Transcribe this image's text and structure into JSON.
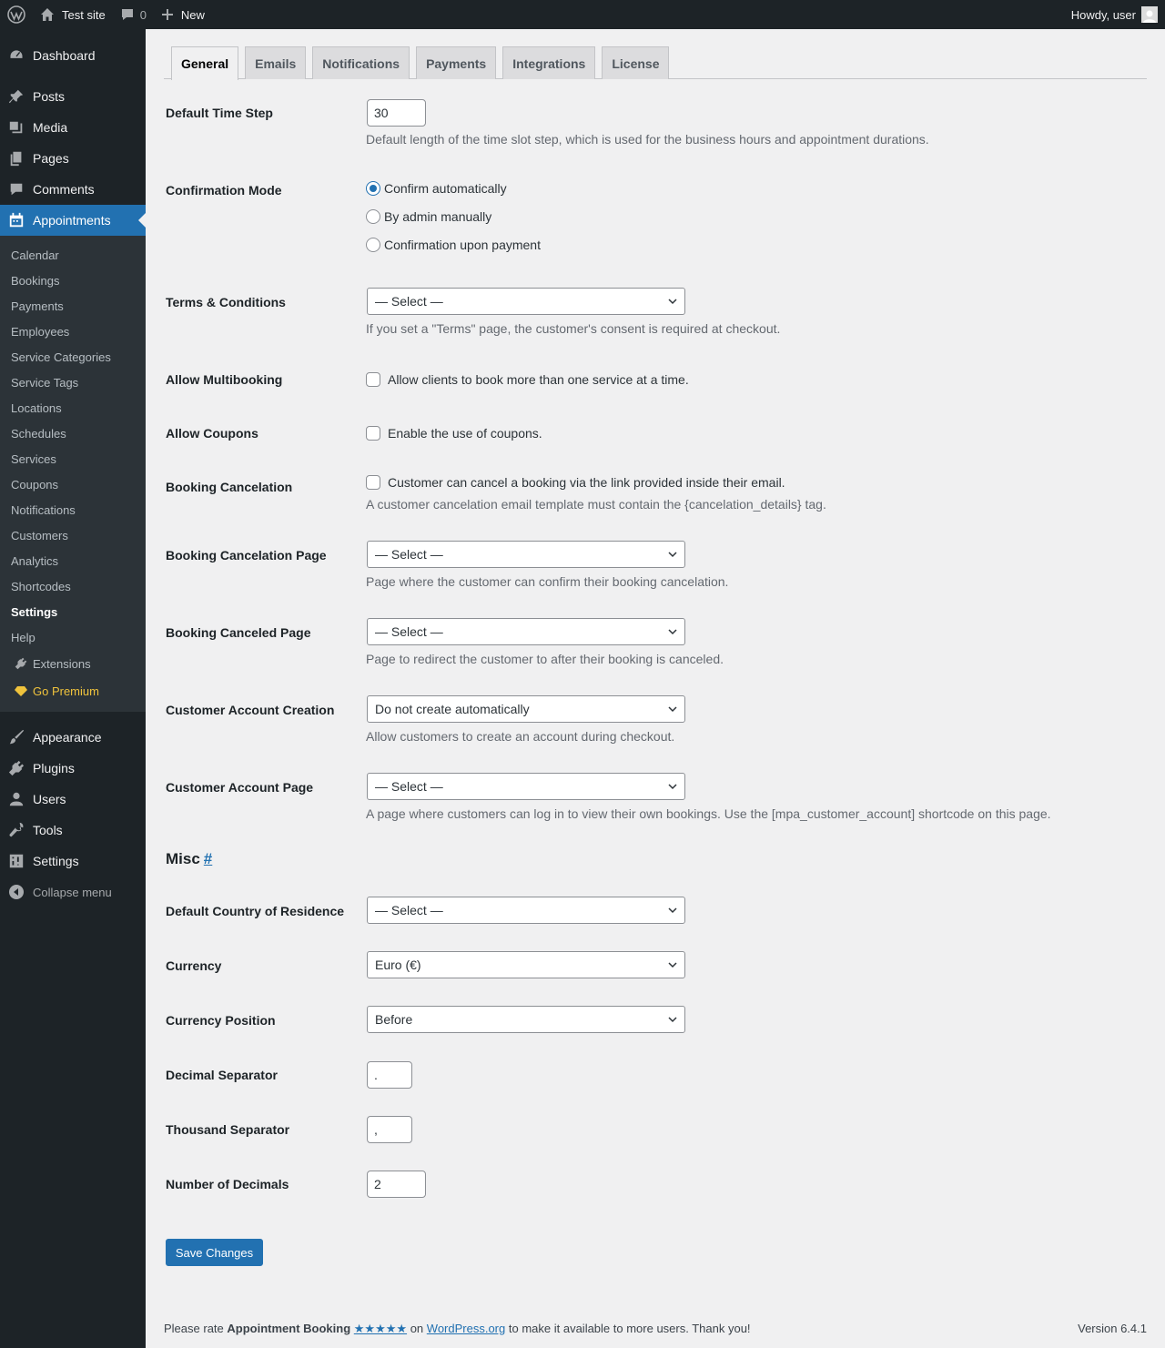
{
  "adminbar": {
    "site_name": "Test site",
    "comments_count": "0",
    "new_label": "New",
    "howdy": "Howdy, user"
  },
  "sidebar": {
    "top_items": [
      {
        "label": "Dashboard",
        "icon": "dashboard-icon"
      },
      {
        "label": "Posts",
        "icon": "pin-icon"
      },
      {
        "label": "Media",
        "icon": "media-icon"
      },
      {
        "label": "Pages",
        "icon": "pages-icon"
      },
      {
        "label": "Comments",
        "icon": "comment-icon"
      },
      {
        "label": "Appointments",
        "icon": "calendar-icon"
      }
    ],
    "submenu": [
      "Calendar",
      "Bookings",
      "Payments",
      "Employees",
      "Service Categories",
      "Service Tags",
      "Locations",
      "Schedules",
      "Services",
      "Coupons",
      "Notifications",
      "Customers",
      "Analytics",
      "Shortcodes",
      "Settings",
      "Help"
    ],
    "extensions": "Extensions",
    "go_premium": "Go Premium",
    "bottom_items": [
      {
        "label": "Appearance",
        "icon": "brush-icon"
      },
      {
        "label": "Plugins",
        "icon": "plugin-icon"
      },
      {
        "label": "Users",
        "icon": "user-icon"
      },
      {
        "label": "Tools",
        "icon": "wrench-icon"
      },
      {
        "label": "Settings",
        "icon": "settings-icon"
      }
    ],
    "collapse": "Collapse menu"
  },
  "tabs": [
    "General",
    "Emails",
    "Notifications",
    "Payments",
    "Integrations",
    "License"
  ],
  "form": {
    "time_step": {
      "label": "Default Time Step",
      "value": "30",
      "desc": "Default length of the time slot step, which is used for the business hours and appointment durations."
    },
    "confirmation": {
      "label": "Confirmation Mode",
      "options": [
        "Confirm automatically",
        "By admin manually",
        "Confirmation upon payment"
      ],
      "selected": "Confirm automatically"
    },
    "terms": {
      "label": "Terms & Conditions",
      "value": "— Select —",
      "desc": "If you set a \"Terms\" page, the customer's consent is required at checkout."
    },
    "multibooking": {
      "label": "Allow Multibooking",
      "text": "Allow clients to book more than one service at a time."
    },
    "coupons": {
      "label": "Allow Coupons",
      "text": "Enable the use of coupons."
    },
    "cancelation": {
      "label": "Booking Cancelation",
      "text": "Customer can cancel a booking via the link provided inside their email.",
      "desc": "A customer cancelation email template must contain the {cancelation_details} tag."
    },
    "cancelation_page": {
      "label": "Booking Cancelation Page",
      "value": "— Select —",
      "desc": "Page where the customer can confirm their booking cancelation."
    },
    "canceled_page": {
      "label": "Booking Canceled Page",
      "value": "— Select —",
      "desc": "Page to redirect the customer to after their booking is canceled."
    },
    "account_creation": {
      "label": "Customer Account Creation",
      "value": "Do not create automatically",
      "desc": "Allow customers to create an account during checkout."
    },
    "account_page": {
      "label": "Customer Account Page",
      "value": "— Select —",
      "desc": "A page where customers can log in to view their own bookings. Use the [mpa_customer_account] shortcode on this page."
    },
    "misc_title": "Misc",
    "misc_anchor": "#",
    "country": {
      "label": "Default Country of Residence",
      "value": "— Select —"
    },
    "currency": {
      "label": "Currency",
      "value": "Euro (€)"
    },
    "currency_position": {
      "label": "Currency Position",
      "value": "Before"
    },
    "decimal_sep": {
      "label": "Decimal Separator",
      "value": "."
    },
    "thousand_sep": {
      "label": "Thousand Separator",
      "value": ","
    },
    "decimals": {
      "label": "Number of Decimals",
      "value": "2"
    },
    "save": "Save Changes"
  },
  "footer": {
    "pre": "Please rate",
    "plugin": "Appointment Booking",
    "stars": "★★★★★",
    "on": "on",
    "link": "WordPress.org",
    "post": "to make it available to more users. Thank you!",
    "version": "Version 6.4.1"
  },
  "colors": {
    "accent": "#2271b1",
    "sidebar": "#1d2327",
    "submenu": "#2c3338",
    "premium": "#f0c33c"
  }
}
